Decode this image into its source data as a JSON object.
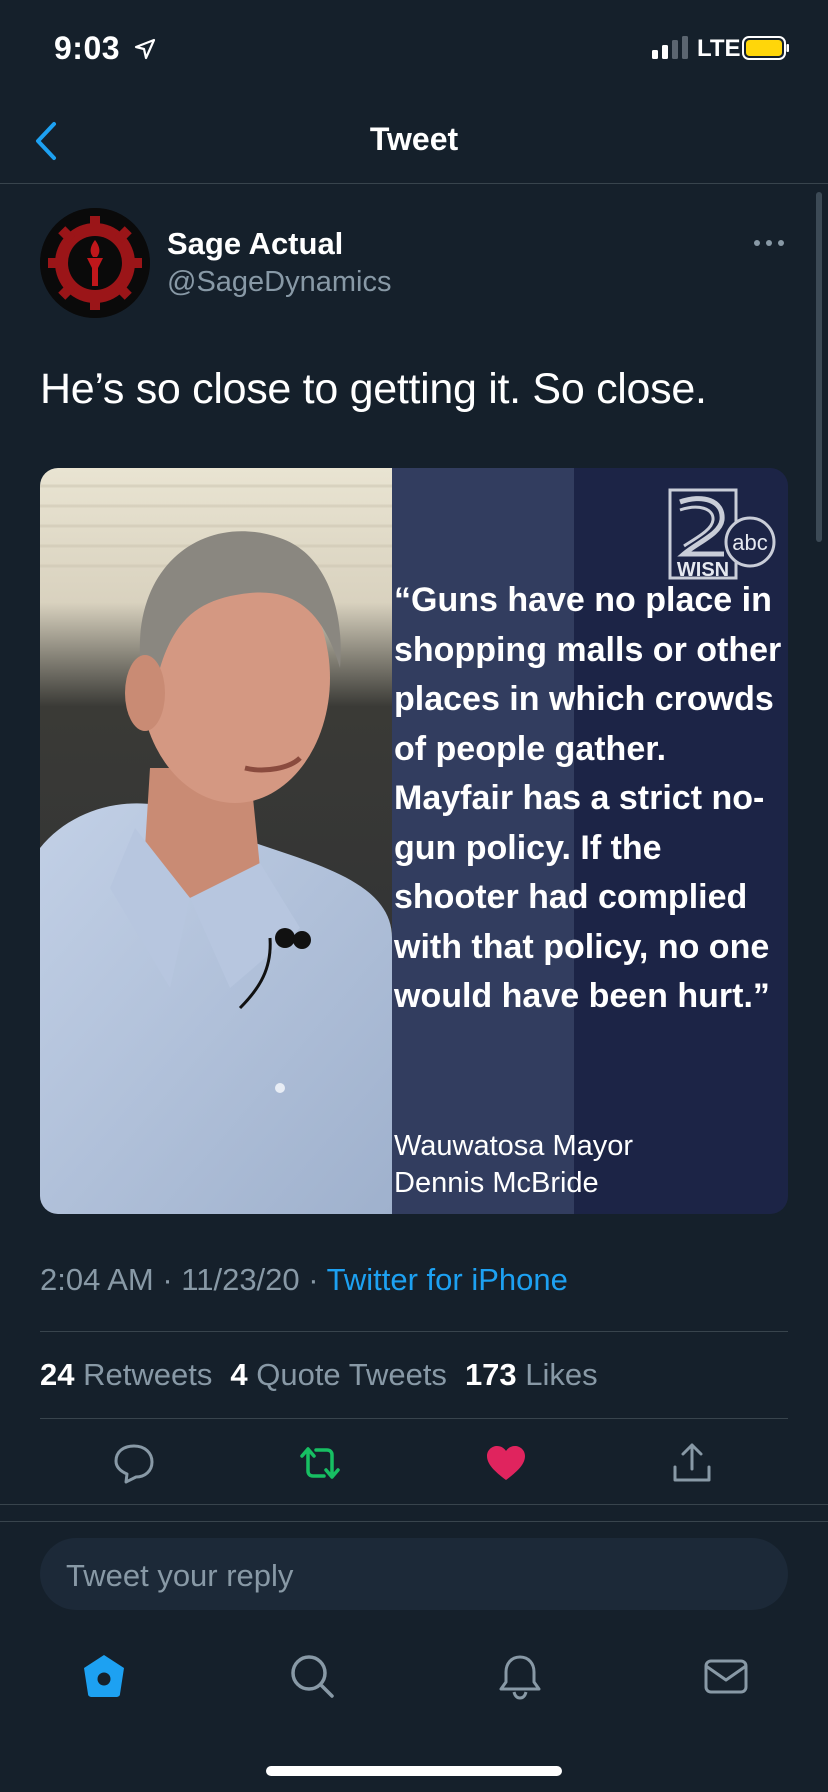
{
  "status_bar": {
    "time": "9:03",
    "network": "LTE",
    "battery_color": "#ffd60a"
  },
  "nav": {
    "title": "Tweet"
  },
  "tweet": {
    "display_name": "Sage Actual",
    "handle": "@SageDynamics",
    "text": "He’s so close to getting it. So close.",
    "timestamp": "2:04 AM · 11/23/20 · ",
    "source": "Twitter for iPhone",
    "image": {
      "quote": "“Guns have no place in shopping malls or other places in which crowds of people gather. Mayfair has a strict no-gun policy. If the shooter had complied with that policy, no one would have been hurt.”",
      "attribution_line1": "Wauwatosa Mayor",
      "attribution_line2": "Dennis McBride",
      "logo_text": "WISN",
      "logo_badge": "abc"
    }
  },
  "stats": {
    "retweets_count": "24",
    "retweets_label": "Retweets",
    "quotes_count": "4",
    "quotes_label": "Quote Tweets",
    "likes_count": "173",
    "likes_label": "Likes"
  },
  "colors": {
    "accent": "#1da1f2",
    "retweet": "#17bf63",
    "like": "#e0245e",
    "background": "#15202b"
  },
  "reply": {
    "placeholder": "Tweet your reply"
  }
}
